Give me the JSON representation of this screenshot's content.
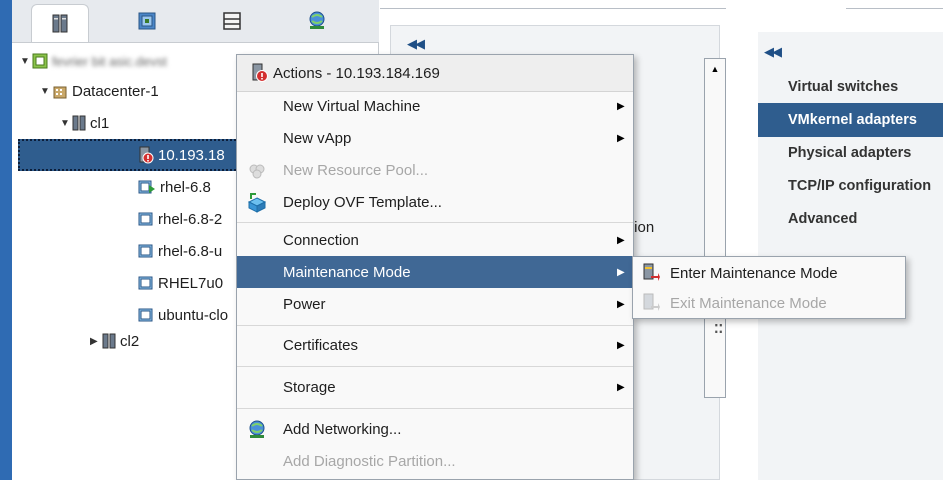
{
  "navigator": {
    "tabs": [
      {
        "name": "hosts-and-clusters",
        "icon": "hosts-clusters-icon"
      },
      {
        "name": "vms-and-templates",
        "icon": "vms-templates-icon"
      },
      {
        "name": "storage",
        "icon": "storage-icon"
      },
      {
        "name": "networking",
        "icon": "networking-icon"
      }
    ],
    "tree": {
      "vcenter_label": "fevrier bit asic.devst",
      "datacenter": "Datacenter-1",
      "cluster1": "cl1",
      "host_selected": "10.193.18",
      "vms": [
        "rhel-6.8",
        "rhel-6.8-2",
        "rhel-6.8-u",
        "RHEL7u0",
        "ubuntu-clo"
      ],
      "cluster2": "cl2"
    }
  },
  "middle_panel": {
    "partial_label": "tion"
  },
  "right_panel": {
    "items": [
      "Virtual switches",
      "VMkernel adapters",
      "Physical adapters",
      "TCP/IP configuration",
      "Advanced"
    ],
    "active_index": 1
  },
  "context_menu": {
    "title": "Actions - 10.193.184.169",
    "items": {
      "new_vm": "New Virtual Machine",
      "new_vapp": "New vApp",
      "new_resource_pool": "New Resource Pool...",
      "deploy_ovf": "Deploy OVF Template...",
      "connection": "Connection",
      "maintenance_mode": "Maintenance Mode",
      "power": "Power",
      "certificates": "Certificates",
      "storage": "Storage",
      "add_networking": "Add Networking...",
      "add_diag_partition": "Add Diagnostic Partition..."
    }
  },
  "submenu": {
    "enter": "Enter Maintenance Mode",
    "exit": "Exit Maintenance Mode"
  },
  "colors": {
    "selection_bg": "#2f5d8e",
    "menu_highlight": "#406895",
    "disabled_text": "#a7a7a7"
  }
}
